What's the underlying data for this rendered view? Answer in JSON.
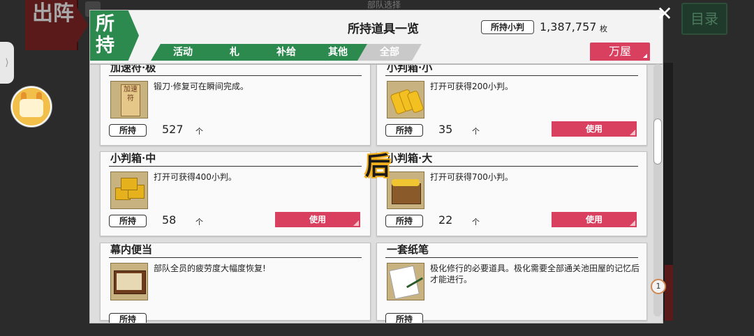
{
  "background": {
    "left_banner_text": "出阵",
    "top_title": "部队选择",
    "right_button_text": "目录",
    "side_tab_glyph": "⟩"
  },
  "header": {
    "badge": "所持",
    "title": "所持道具一览",
    "koban_label": "所持小判",
    "koban_value": "1,387,757",
    "koban_unit": "枚",
    "shop_button": "万屋",
    "tabs": [
      {
        "label": "活动",
        "active": true
      },
      {
        "label": "札",
        "active": true
      },
      {
        "label": "补给",
        "active": true
      },
      {
        "label": "其他",
        "active": true
      },
      {
        "label": "全部",
        "active": false
      }
    ]
  },
  "items": [
    {
      "name": "加速符·极",
      "desc": "锻刀·修复可在瞬间完成。",
      "own_label": "所持",
      "count": "527",
      "unit": "个",
      "use_label": "",
      "icon": "talisman-icon",
      "thumb_text": "加速符"
    },
    {
      "name": "小判箱·小",
      "desc": "打开可获得200小判。",
      "own_label": "所持",
      "count": "35",
      "unit": "个",
      "use_label": "使用",
      "icon": "gold-bars-icon"
    },
    {
      "name": "小判箱·中",
      "desc": "打开可获得400小判。",
      "own_label": "所持",
      "count": "58",
      "unit": "个",
      "use_label": "使用",
      "icon": "gold-box-icon"
    },
    {
      "name": "小判箱·大",
      "desc": "打开可获得700小判。",
      "own_label": "所持",
      "count": "22",
      "unit": "个",
      "use_label": "使用",
      "icon": "treasure-chest-icon"
    },
    {
      "name": "幕内便当",
      "desc": "部队全员的疲劳度大幅度恢复!",
      "own_label": "所持",
      "count": "",
      "unit": "",
      "use_label": "",
      "icon": "bento-icon"
    },
    {
      "name": "一套纸笔",
      "desc": "极化修行的必要道具。极化需要全部通关池田屋的记忆后才能进行。",
      "own_label": "所持",
      "count": "",
      "unit": "",
      "use_label": "",
      "icon": "paper-brush-icon"
    }
  ],
  "overlay_glyph": "后",
  "page_indicator": "1",
  "close_glyph": "✕",
  "colors": {
    "accent_green": "#2d8a4e",
    "accent_pink": "#d9405f"
  }
}
